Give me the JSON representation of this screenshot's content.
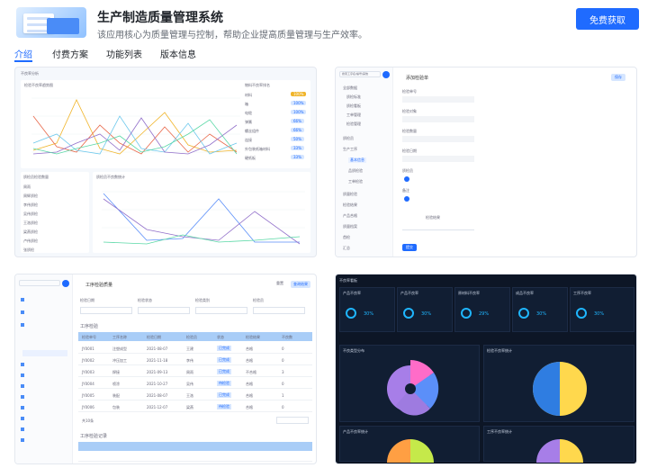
{
  "header": {
    "title": "生产制造质量管理系统",
    "subtitle": "该应用核心为质量管理与控制，帮助企业提高质量管理与生产效率。",
    "cta_label": "免费获取",
    "logo_text": "质量分析"
  },
  "tabs": [
    {
      "label": "介绍",
      "active": true
    },
    {
      "label": "付费方案",
      "active": false
    },
    {
      "label": "功能列表",
      "active": false
    },
    {
      "label": "版本信息",
      "active": false
    }
  ],
  "colors": {
    "accent": "#1f6bff",
    "dark_bg": "#0d1626"
  },
  "screens": {
    "s1": {
      "title": "不良率分析",
      "chart1_title": "检验不良率趋势图",
      "chart2_title": "质检员检验数量",
      "chart3_title": "质检员不良数统计",
      "side_title": "物料不良率排名",
      "side_items": [
        "材料",
        "箱",
        "电缆",
        "弹簧",
        "螺丝组件",
        "连接",
        "外包装纸箱材料",
        "硬纸板"
      ],
      "side_badges": [
        "100%",
        "100%",
        "100%",
        "66%",
        "66%",
        "50%",
        "33%",
        "33%"
      ],
      "left_items": [
        "周雨",
        "周辉质检",
        "李伟质检",
        "吴伟质检",
        "王洛质检",
        "梁燕质检",
        "卢伟质检",
        "张质检"
      ]
    },
    "s2": {
      "search_placeholder": "搜索工序名/编号/其他",
      "nav": [
        "全部数据",
        "质检标准",
        "质检看板",
        "工单管理",
        "检验管理",
        "质检员",
        "生产工序",
        "基本信息",
        "品质检验",
        "工单检验",
        "质量检验",
        "检验结果",
        "产品合格",
        "质量档案",
        "首检",
        "汇总"
      ],
      "form_title": "添加检验单",
      "save_label": "保存",
      "fields": [
        "检验单号",
        "检验对象",
        "检验数量",
        "检验日期",
        "质检员",
        "备注",
        "检验结果"
      ],
      "submit_label": "提交"
    },
    "s3": {
      "title": "工序检验质量",
      "filters": [
        "检验日期",
        "检验状态",
        "检验类别",
        "检验员"
      ],
      "buttons": [
        "重置",
        "查询结果"
      ],
      "table_title": "工序检验",
      "cols": [
        "检验单号",
        "工序名称",
        "检验日期",
        "检验员",
        "状态",
        "检验结果",
        "不良数"
      ],
      "rows": [
        [
          "JY0001",
          "注塑成型",
          "2021-08-07",
          "王建",
          "已完成",
          "合格",
          "0"
        ],
        [
          "JY0002",
          "冲压加工",
          "2021-11-18",
          "李伟",
          "已完成",
          "合格",
          "0"
        ],
        [
          "JY0003",
          "焊接",
          "2021-09-13",
          "周雨",
          "已完成",
          "不合格",
          "3"
        ],
        [
          "JY0004",
          "喷涂",
          "2021-10-27",
          "吴伟",
          "待检验",
          "合格",
          "0"
        ],
        [
          "JY0005",
          "装配",
          "2021-08-07",
          "王洛",
          "已完成",
          "合格",
          "1"
        ],
        [
          "JY0006",
          "包装",
          "2021-12-07",
          "梁燕",
          "待检验",
          "合格",
          "0"
        ]
      ],
      "pager": "共10条",
      "table2_title": "工序检验记录"
    },
    "s4": {
      "title": "不良率看板",
      "kpis": [
        {
          "title": "产品不良率",
          "value": "30%"
        },
        {
          "title": "产品不良率",
          "value": "30%"
        },
        {
          "title": "原材料不良率",
          "value": "29%"
        },
        {
          "title": "成品不良率",
          "value": "30%"
        },
        {
          "title": "工序不良率",
          "value": "30%"
        }
      ],
      "p1": "不良类型分布",
      "p2": "检验不良率统计",
      "p3": "产品不良率统计",
      "p4": "工序不良率统计"
    }
  }
}
